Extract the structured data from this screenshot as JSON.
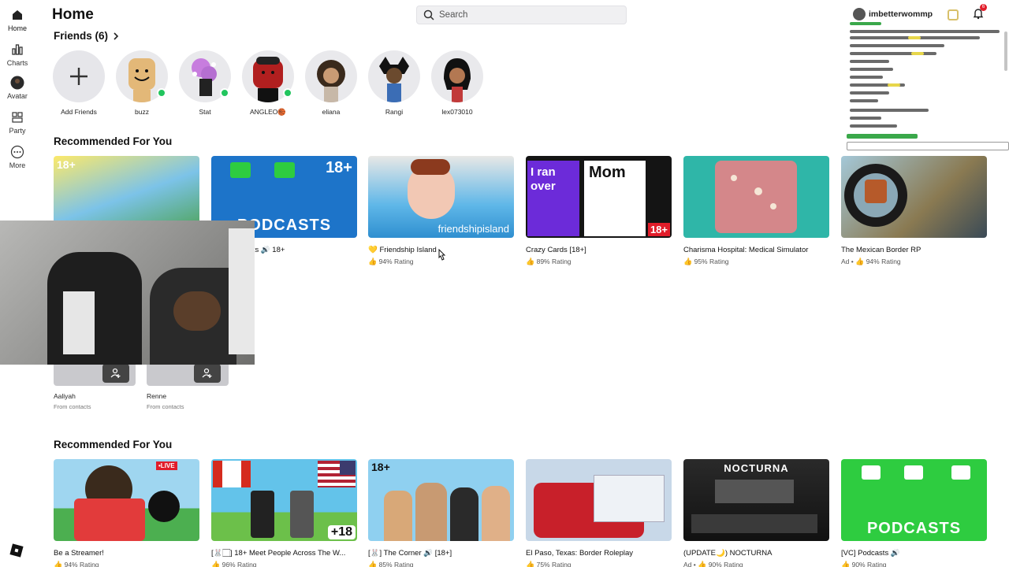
{
  "nav": {
    "items": [
      {
        "label": "Home",
        "icon": "home-icon"
      },
      {
        "label": "Charts",
        "icon": "charts-icon"
      },
      {
        "label": "Avatar",
        "icon": "avatar-icon"
      },
      {
        "label": "Party",
        "icon": "party-icon"
      },
      {
        "label": "More",
        "icon": "more-icon"
      }
    ]
  },
  "header": {
    "title": "Home",
    "search_placeholder": "Search",
    "username": "imbetterwommp",
    "notification_count": "6"
  },
  "friends": {
    "title": "Friends (6)",
    "add_label": "Add Friends",
    "list": [
      {
        "name": "buzz",
        "online": true
      },
      {
        "name": "Stat",
        "online": true
      },
      {
        "name": "ANGLEO🏀",
        "online": true
      },
      {
        "name": "eliana",
        "online": false
      },
      {
        "name": "Rangi",
        "online": false
      },
      {
        "name": "lex073010",
        "online": false
      }
    ]
  },
  "rec1": {
    "title": "Recommended For You",
    "cards": [
      {
        "title": "",
        "rating": "",
        "badge": "18+",
        "color": "#7cc3e8"
      },
      {
        "title": "[VC] Podcasts 🔊 18+",
        "rating": "",
        "badge": "18+",
        "color": "#1d74c9"
      },
      {
        "title": "💛 Friendship Island",
        "rating": "94% Rating",
        "color": "#5fb7e8"
      },
      {
        "title": "Crazy Cards [18+]",
        "rating": "89% Rating",
        "color": "#6c2bd9"
      },
      {
        "title": "Charisma Hospital: Medical Simulator",
        "rating": "95% Rating",
        "color": "#2fb6a8"
      },
      {
        "title": "The Mexican Border RP",
        "rating": "94% Rating",
        "ad": "Ad •",
        "color": "#3a4a56"
      }
    ],
    "thumb_text": {
      "podcasts": "PODCASTS",
      "friendship": "friendshipisland",
      "iranover": "I ran over",
      "mom": "Mom",
      "badge18": "18+"
    }
  },
  "contacts": [
    {
      "name": "Aaliyah",
      "sub": "From contacts"
    },
    {
      "name": "Renne",
      "sub": "From contacts"
    }
  ],
  "rec2": {
    "title": "Recommended For You",
    "cards": [
      {
        "title": "Be a Streamer!",
        "rating": "94% Rating",
        "color": "#e23b3b"
      },
      {
        "title": "[🐰🏻] 18+ Meet People Across The W...",
        "rating": "96% Rating",
        "color": "#63c3ea"
      },
      {
        "title": "[🐰] The Corner 🔊 [18+]",
        "rating": "85% Rating",
        "badge": "18+",
        "color": "#8fd0f0"
      },
      {
        "title": "El Paso, Texas: Border Roleplay",
        "rating": "75% Rating",
        "color": "#c8d8e8"
      },
      {
        "title": "(UPDATE🌙) NOCTURNA",
        "rating": "90% Rating",
        "ad": "Ad •",
        "color": "#222222"
      },
      {
        "title": "[VC] Podcasts 🔊",
        "rating": "90% Rating",
        "color": "#2ecc40"
      }
    ],
    "thumb_text": {
      "live": "•LIVE",
      "plus18": "+18",
      "nocturna": "NOCTURNA",
      "podcasts": "PODCASTS"
    }
  }
}
